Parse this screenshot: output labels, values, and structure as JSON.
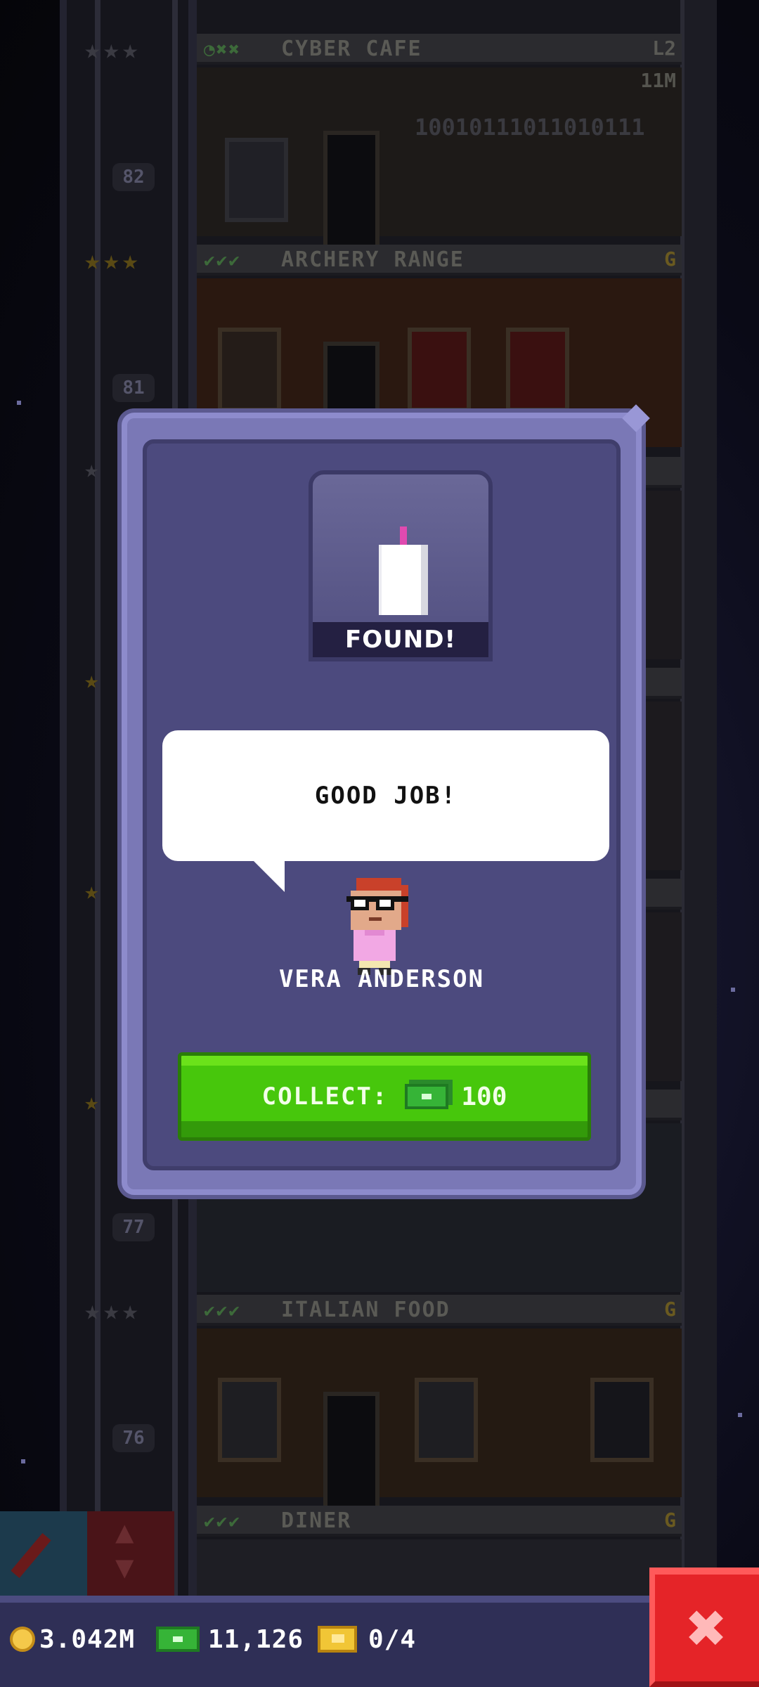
{
  "modal": {
    "item_status": "FOUND!",
    "speech": "GOOD JOB!",
    "character_name": "VERA ANDERSON",
    "collect_label": "COLLECT:",
    "collect_amount": "100",
    "collect_icon": "cash-icon"
  },
  "status_bar": {
    "coins": "3.042M",
    "bux": "11,126",
    "tickets": "0/4",
    "close_icon": "close-icon"
  },
  "background_floors": [
    {
      "name": "CYBER CAFE",
      "level": "L2",
      "income": "11M",
      "checks": "◔✖✖",
      "number": "82"
    },
    {
      "name": "ARCHERY RANGE",
      "level": "G",
      "checks": "✔✔✔",
      "number": "81"
    },
    {
      "name": "ITALIAN FOOD",
      "level": "G",
      "checks": "✔✔✔",
      "number": "76"
    },
    {
      "name": "DINER",
      "level": "G",
      "checks": "✔✔✔"
    }
  ],
  "floor_number_77": "77",
  "cyber_binary": "10010111011010111",
  "colors": {
    "collect_green": "#47c70c",
    "modal_purple": "#4c4a7e",
    "close_red": "#e52428"
  }
}
